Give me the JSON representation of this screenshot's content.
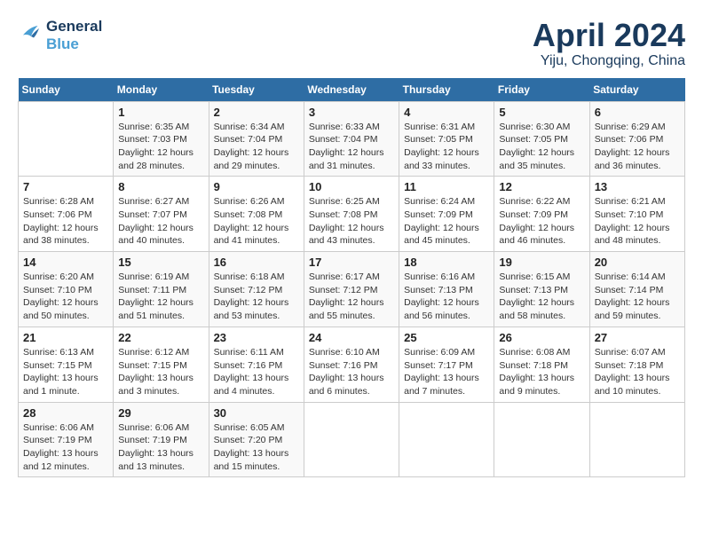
{
  "header": {
    "logo_line1": "General",
    "logo_line2": "Blue",
    "month_title": "April 2024",
    "location": "Yiju, Chongqing, China"
  },
  "calendar": {
    "days_of_week": [
      "Sunday",
      "Monday",
      "Tuesday",
      "Wednesday",
      "Thursday",
      "Friday",
      "Saturday"
    ],
    "weeks": [
      [
        {
          "day": "",
          "info": ""
        },
        {
          "day": "1",
          "info": "Sunrise: 6:35 AM\nSunset: 7:03 PM\nDaylight: 12 hours\nand 28 minutes."
        },
        {
          "day": "2",
          "info": "Sunrise: 6:34 AM\nSunset: 7:04 PM\nDaylight: 12 hours\nand 29 minutes."
        },
        {
          "day": "3",
          "info": "Sunrise: 6:33 AM\nSunset: 7:04 PM\nDaylight: 12 hours\nand 31 minutes."
        },
        {
          "day": "4",
          "info": "Sunrise: 6:31 AM\nSunset: 7:05 PM\nDaylight: 12 hours\nand 33 minutes."
        },
        {
          "day": "5",
          "info": "Sunrise: 6:30 AM\nSunset: 7:05 PM\nDaylight: 12 hours\nand 35 minutes."
        },
        {
          "day": "6",
          "info": "Sunrise: 6:29 AM\nSunset: 7:06 PM\nDaylight: 12 hours\nand 36 minutes."
        }
      ],
      [
        {
          "day": "7",
          "info": "Sunrise: 6:28 AM\nSunset: 7:06 PM\nDaylight: 12 hours\nand 38 minutes."
        },
        {
          "day": "8",
          "info": "Sunrise: 6:27 AM\nSunset: 7:07 PM\nDaylight: 12 hours\nand 40 minutes."
        },
        {
          "day": "9",
          "info": "Sunrise: 6:26 AM\nSunset: 7:08 PM\nDaylight: 12 hours\nand 41 minutes."
        },
        {
          "day": "10",
          "info": "Sunrise: 6:25 AM\nSunset: 7:08 PM\nDaylight: 12 hours\nand 43 minutes."
        },
        {
          "day": "11",
          "info": "Sunrise: 6:24 AM\nSunset: 7:09 PM\nDaylight: 12 hours\nand 45 minutes."
        },
        {
          "day": "12",
          "info": "Sunrise: 6:22 AM\nSunset: 7:09 PM\nDaylight: 12 hours\nand 46 minutes."
        },
        {
          "day": "13",
          "info": "Sunrise: 6:21 AM\nSunset: 7:10 PM\nDaylight: 12 hours\nand 48 minutes."
        }
      ],
      [
        {
          "day": "14",
          "info": "Sunrise: 6:20 AM\nSunset: 7:10 PM\nDaylight: 12 hours\nand 50 minutes."
        },
        {
          "day": "15",
          "info": "Sunrise: 6:19 AM\nSunset: 7:11 PM\nDaylight: 12 hours\nand 51 minutes."
        },
        {
          "day": "16",
          "info": "Sunrise: 6:18 AM\nSunset: 7:12 PM\nDaylight: 12 hours\nand 53 minutes."
        },
        {
          "day": "17",
          "info": "Sunrise: 6:17 AM\nSunset: 7:12 PM\nDaylight: 12 hours\nand 55 minutes."
        },
        {
          "day": "18",
          "info": "Sunrise: 6:16 AM\nSunset: 7:13 PM\nDaylight: 12 hours\nand 56 minutes."
        },
        {
          "day": "19",
          "info": "Sunrise: 6:15 AM\nSunset: 7:13 PM\nDaylight: 12 hours\nand 58 minutes."
        },
        {
          "day": "20",
          "info": "Sunrise: 6:14 AM\nSunset: 7:14 PM\nDaylight: 12 hours\nand 59 minutes."
        }
      ],
      [
        {
          "day": "21",
          "info": "Sunrise: 6:13 AM\nSunset: 7:15 PM\nDaylight: 13 hours\nand 1 minute."
        },
        {
          "day": "22",
          "info": "Sunrise: 6:12 AM\nSunset: 7:15 PM\nDaylight: 13 hours\nand 3 minutes."
        },
        {
          "day": "23",
          "info": "Sunrise: 6:11 AM\nSunset: 7:16 PM\nDaylight: 13 hours\nand 4 minutes."
        },
        {
          "day": "24",
          "info": "Sunrise: 6:10 AM\nSunset: 7:16 PM\nDaylight: 13 hours\nand 6 minutes."
        },
        {
          "day": "25",
          "info": "Sunrise: 6:09 AM\nSunset: 7:17 PM\nDaylight: 13 hours\nand 7 minutes."
        },
        {
          "day": "26",
          "info": "Sunrise: 6:08 AM\nSunset: 7:18 PM\nDaylight: 13 hours\nand 9 minutes."
        },
        {
          "day": "27",
          "info": "Sunrise: 6:07 AM\nSunset: 7:18 PM\nDaylight: 13 hours\nand 10 minutes."
        }
      ],
      [
        {
          "day": "28",
          "info": "Sunrise: 6:06 AM\nSunset: 7:19 PM\nDaylight: 13 hours\nand 12 minutes."
        },
        {
          "day": "29",
          "info": "Sunrise: 6:06 AM\nSunset: 7:19 PM\nDaylight: 13 hours\nand 13 minutes."
        },
        {
          "day": "30",
          "info": "Sunrise: 6:05 AM\nSunset: 7:20 PM\nDaylight: 13 hours\nand 15 minutes."
        },
        {
          "day": "",
          "info": ""
        },
        {
          "day": "",
          "info": ""
        },
        {
          "day": "",
          "info": ""
        },
        {
          "day": "",
          "info": ""
        }
      ]
    ]
  }
}
